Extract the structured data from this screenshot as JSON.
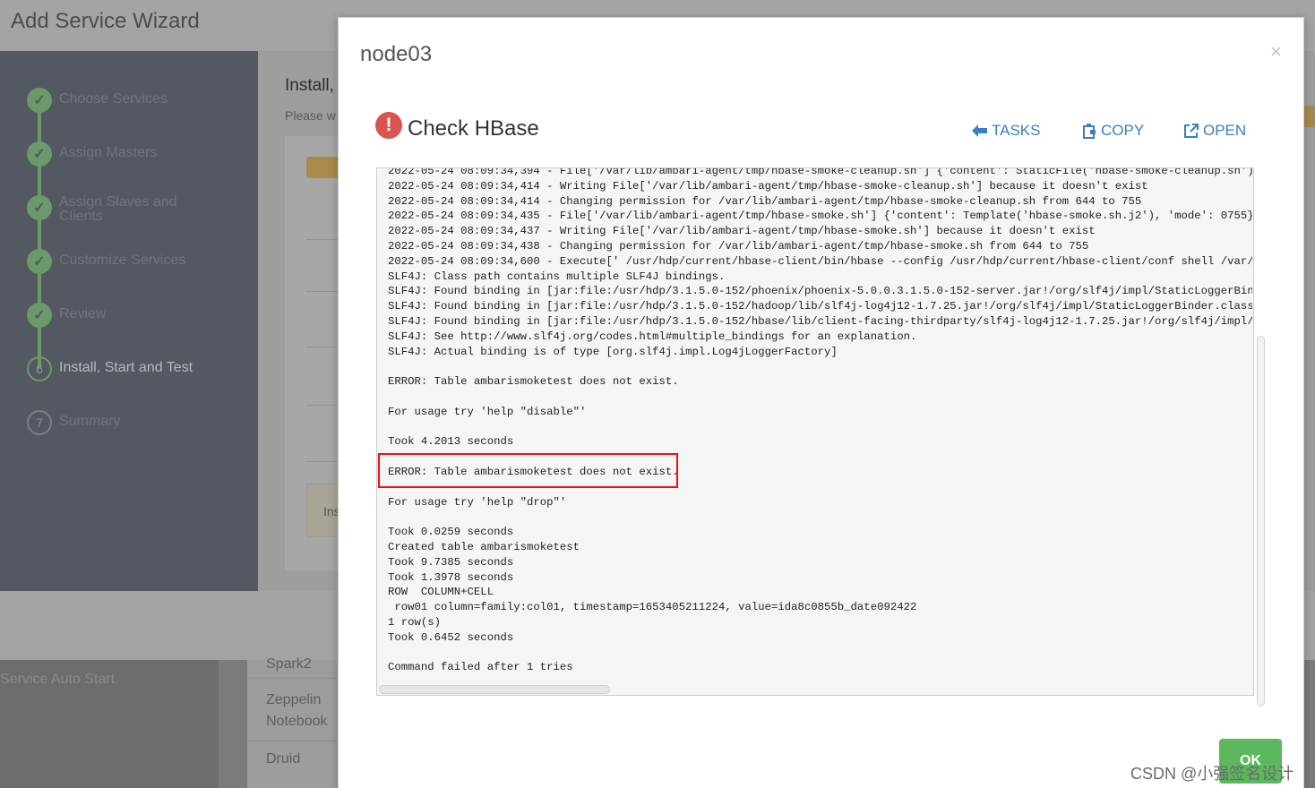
{
  "background": {
    "wizard_title": "Add Service Wizard",
    "main_title": "Install,",
    "main_subtitle": "Please w",
    "info_fragment": "Ins",
    "lower_left_text": "Service Auto Start",
    "lower_list": [
      "Spark2",
      "Zeppelin",
      "Notebook",
      "Druid"
    ],
    "steps": [
      {
        "number": "✓",
        "label": "Choose Services",
        "state": "done"
      },
      {
        "number": "✓",
        "label": "Assign Masters",
        "state": "done"
      },
      {
        "number": "✓",
        "label": "Assign Slaves and Clients",
        "state": "done"
      },
      {
        "number": "✓",
        "label": "Customize Services",
        "state": "done"
      },
      {
        "number": "✓",
        "label": "Review",
        "state": "done"
      },
      {
        "number": "6",
        "label": "Install, Start and Test",
        "state": "current"
      },
      {
        "number": "7",
        "label": "Summary",
        "state": "future"
      }
    ]
  },
  "modal": {
    "title": "node03",
    "close": "×",
    "task_icon": "!",
    "task_title": "Check HBase",
    "actions": {
      "tasks": "TASKS",
      "copy": "COPY",
      "open": "OPEN"
    },
    "log_text": "2022-05-24 08:09:34,394 - File['/var/lib/ambari-agent/tmp/hbase-smoke-cleanup.sh'] {'content': StaticFile('hbase-smoke-cleanup.sh'), 'mode'\n2022-05-24 08:09:34,414 - Writing File['/var/lib/ambari-agent/tmp/hbase-smoke-cleanup.sh'] because it doesn't exist\n2022-05-24 08:09:34,414 - Changing permission for /var/lib/ambari-agent/tmp/hbase-smoke-cleanup.sh from 644 to 755\n2022-05-24 08:09:34,435 - File['/var/lib/ambari-agent/tmp/hbase-smoke.sh'] {'content': Template('hbase-smoke.sh.j2'), 'mode': 0755}\n2022-05-24 08:09:34,437 - Writing File['/var/lib/ambari-agent/tmp/hbase-smoke.sh'] because it doesn't exist\n2022-05-24 08:09:34,438 - Changing permission for /var/lib/ambari-agent/tmp/hbase-smoke.sh from 644 to 755\n2022-05-24 08:09:34,600 - Execute[' /usr/hdp/current/hbase-client/bin/hbase --config /usr/hdp/current/hbase-client/conf shell /var/lib/amb\nSLF4J: Class path contains multiple SLF4J bindings.\nSLF4J: Found binding in [jar:file:/usr/hdp/3.1.5.0-152/phoenix/phoenix-5.0.0.3.1.5.0-152-server.jar!/org/slf4j/impl/StaticLoggerBinder.cla\nSLF4J: Found binding in [jar:file:/usr/hdp/3.1.5.0-152/hadoop/lib/slf4j-log4j12-1.7.25.jar!/org/slf4j/impl/StaticLoggerBinder.class]\nSLF4J: Found binding in [jar:file:/usr/hdp/3.1.5.0-152/hbase/lib/client-facing-thirdparty/slf4j-log4j12-1.7.25.jar!/org/slf4j/impl/StaticL\nSLF4J: See http://www.slf4j.org/codes.html#multiple_bindings for an explanation.\nSLF4J: Actual binding is of type [org.slf4j.impl.Log4jLoggerFactory]\n\nERROR: Table ambarismoketest does not exist.\n\nFor usage try 'help \"disable\"'\n\nTook 4.2013 seconds\n\nERROR: Table ambarismoketest does not exist.\n\nFor usage try 'help \"drop\"'\n\nTook 0.0259 seconds\nCreated table ambarismoketest\nTook 9.7385 seconds\nTook 1.3978 seconds\nROW  COLUMN+CELL\n row01 column=family:col01, timestamp=1653405211224, value=ida8c0855b_date092422\n1 row(s)\nTook 0.6452 seconds\n\nCommand failed after 1 tries",
    "ok_label": "OK"
  },
  "watermark": "CSDN @小强签名设计",
  "colors": {
    "accent": "#3a7fbf",
    "error_icon": "#d9534f",
    "ok_button": "#5cb85c",
    "highlight_box": "#ee1111"
  }
}
